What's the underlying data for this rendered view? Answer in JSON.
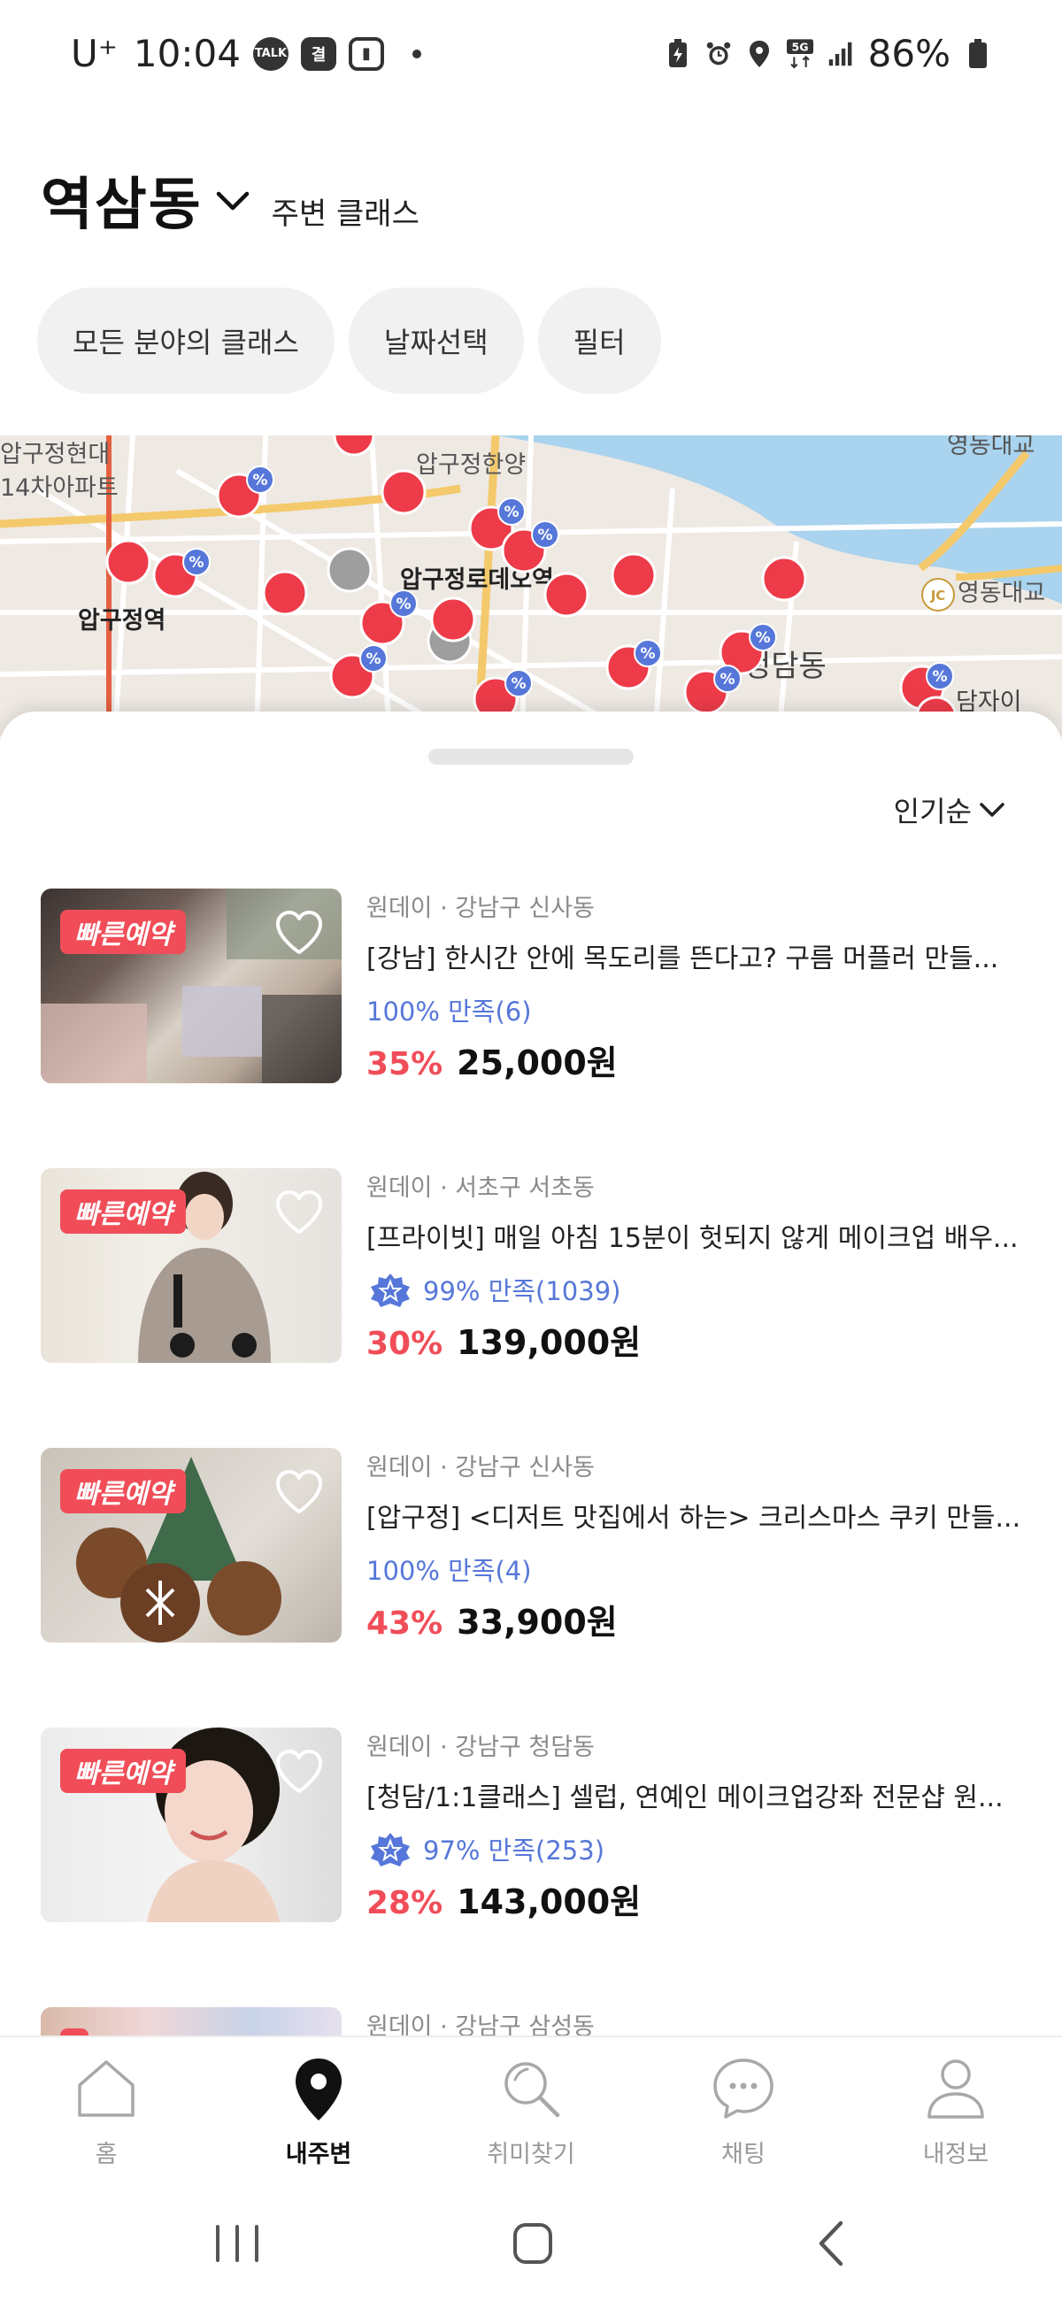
{
  "status_bar": {
    "carrier": "U⁺",
    "time": "10:04",
    "left_icons": [
      "TALK",
      "결",
      "▮"
    ],
    "battery_text": "86%",
    "network": "5G"
  },
  "header": {
    "location": "역삼동",
    "subtitle": "주변 클래스"
  },
  "filters": [
    {
      "label": "모든 분야의 클래스"
    },
    {
      "label": "날짜선택"
    },
    {
      "label": "필터"
    }
  ],
  "map": {
    "labels": [
      "압구정현대",
      "14차아파트",
      "압구정역",
      "압구정한양",
      "압구정로데오역",
      "청담동",
      "영동대교",
      "영동대교",
      "담자이"
    ]
  },
  "sort": {
    "label": "인기순"
  },
  "listings": [
    {
      "badge": "빠른예약",
      "meta": "원데이 · 강남구 신사동",
      "title": "[강남] 한시간 안에 목도리를 뜬다고? 구름 머플러 만들...",
      "rating": "100% 만족(6)",
      "rating_badge": false,
      "discount": "35%",
      "price": "25,000원"
    },
    {
      "badge": "빠른예약",
      "meta": "원데이 · 서초구 서초동",
      "title": "[프라이빗] 매일 아침 15분이 헛되지 않게 메이크업 배우...",
      "rating": "99% 만족(1039)",
      "rating_badge": true,
      "discount": "30%",
      "price": "139,000원"
    },
    {
      "badge": "빠른예약",
      "meta": "원데이 · 강남구 신사동",
      "title": "[압구정] <디저트 맛집에서 하는> 크리스마스 쿠키 만들...",
      "rating": "100% 만족(4)",
      "rating_badge": false,
      "discount": "43%",
      "price": "33,900원"
    },
    {
      "badge": "빠른예약",
      "meta": "원데이 · 강남구 청담동",
      "title": "[청담/1:1클래스] 셀럽, 연예인 메이크업강좌 전문샵 원...",
      "rating": "97% 만족(253)",
      "rating_badge": true,
      "discount": "28%",
      "price": "143,000원"
    },
    {
      "meta": "원데이 · 강남구 삼성동"
    }
  ],
  "bottom_nav": [
    {
      "label": "홈",
      "icon": "home-icon",
      "active": false
    },
    {
      "label": "내주변",
      "icon": "location-pin-icon",
      "active": true
    },
    {
      "label": "취미찾기",
      "icon": "search-icon",
      "active": false
    },
    {
      "label": "채팅",
      "icon": "chat-icon",
      "active": false
    },
    {
      "label": "내정보",
      "icon": "user-icon",
      "active": false
    }
  ],
  "colors": {
    "accent": "#f04d58",
    "rating_blue": "#5677d9",
    "map_marker": "#ee3b49",
    "map_water": "#a9d3ee"
  }
}
